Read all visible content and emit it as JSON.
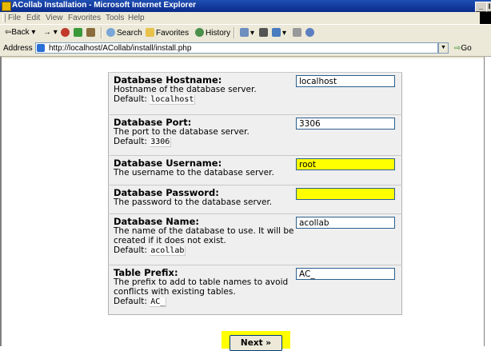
{
  "window": {
    "title": "ACollab Installation - Microsoft Internet Explorer",
    "min_glyph": "_",
    "max_glyph": "I"
  },
  "menu": [
    "File",
    "Edit",
    "View",
    "Favorites",
    "Tools",
    "Help"
  ],
  "toolbar": {
    "back": "Back",
    "forward_arrow": "→",
    "search": "Search",
    "favorites": "Favorites",
    "history": "History"
  },
  "address": {
    "label": "Address",
    "url": "http://localhost/ACollab/install/install.php",
    "go": "Go"
  },
  "fields": [
    {
      "name": "Database Hostname:",
      "help": "Hostname of the database server.",
      "default_label": "Default:",
      "default_value": "localhost",
      "value": "localhost",
      "highlighted": false
    },
    {
      "name": "Database Port:",
      "help": "The port to the database server.",
      "default_label": "Default:",
      "default_value": "3306",
      "value": "3306",
      "highlighted": false
    },
    {
      "name": "Database Username:",
      "help": "The username to the database server.",
      "default_label": "",
      "default_value": "",
      "value": "root",
      "highlighted": true
    },
    {
      "name": "Database Password:",
      "help": "The password to the database server.",
      "default_label": "",
      "default_value": "",
      "value": "",
      "highlighted": true
    },
    {
      "name": "Database Name:",
      "help": "The name of the database to use. It will be created if it does not exist.",
      "default_label": "Default:",
      "default_value": "acollab",
      "value": "acollab",
      "highlighted": false
    },
    {
      "name": "Table Prefix:",
      "help": "The prefix to add to table names to avoid conflicts with existing tables.",
      "default_label": "Default:",
      "default_value": "AC_",
      "value": "AC_",
      "highlighted": false
    }
  ],
  "next_button": "Next »",
  "colors": {
    "highlight": "#ffff00",
    "titlebar": "#0a2a8c",
    "form_bg": "#efefef"
  }
}
